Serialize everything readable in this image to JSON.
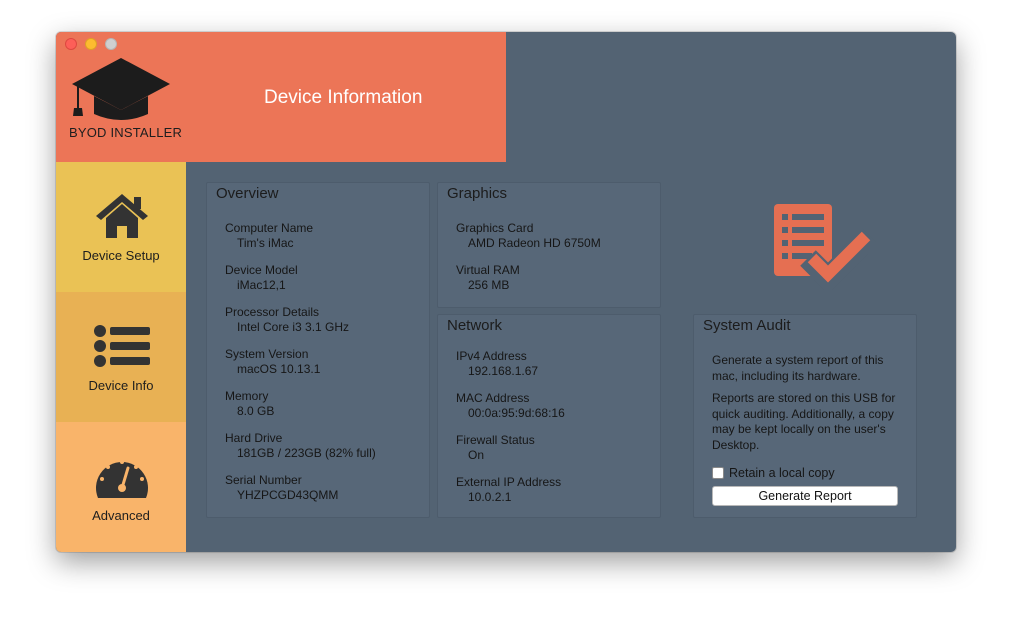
{
  "window": {
    "title": "Device Information"
  },
  "brand": {
    "name": "BYOD INSTALLER",
    "accent": "#ec7557"
  },
  "sidebar": {
    "items": [
      {
        "label": "Device Setup",
        "icon": "home-icon",
        "color": "#eac255"
      },
      {
        "label": "Device Info",
        "icon": "list-icon",
        "color": "#e8b154"
      },
      {
        "label": "Advanced",
        "icon": "gauge-icon",
        "color": "#f9b46a"
      }
    ]
  },
  "overview": {
    "title": "Overview",
    "fields": [
      {
        "label": "Computer Name",
        "value": "Tim's iMac"
      },
      {
        "label": "Device Model",
        "value": "iMac12,1"
      },
      {
        "label": "Processor Details",
        "value": "Intel Core i3 3.1 GHz"
      },
      {
        "label": "System Version",
        "value": "macOS 10.13.1"
      },
      {
        "label": "Memory",
        "value": "8.0 GB"
      },
      {
        "label": "Hard Drive",
        "value": "181GB / 223GB (82% full)"
      },
      {
        "label": "Serial Number",
        "value": "YHZPCGD43QMM"
      }
    ]
  },
  "graphics": {
    "title": "Graphics",
    "fields": [
      {
        "label": "Graphics Card",
        "value": "AMD Radeon HD 6750M"
      },
      {
        "label": "Virtual RAM",
        "value": "256 MB"
      }
    ]
  },
  "network": {
    "title": "Network",
    "fields": [
      {
        "label": "IPv4 Address",
        "value": "192.168.1.67"
      },
      {
        "label": "MAC Address",
        "value": "00:0a:95:9d:68:16"
      },
      {
        "label": "Firewall Status",
        "value": "On"
      },
      {
        "label": "External IP Address",
        "value": "10.0.2.1"
      }
    ]
  },
  "audit": {
    "title": "System Audit",
    "description": "Generate a system report of this mac, including its hardware.",
    "note": "Reports are stored on this USB for quick auditing. Additionally, a copy may be kept locally on the user's Desktop.",
    "checkbox_label": "Retain a local copy",
    "checkbox_checked": false,
    "button_label": "Generate Report",
    "icon": "report-check-icon"
  }
}
